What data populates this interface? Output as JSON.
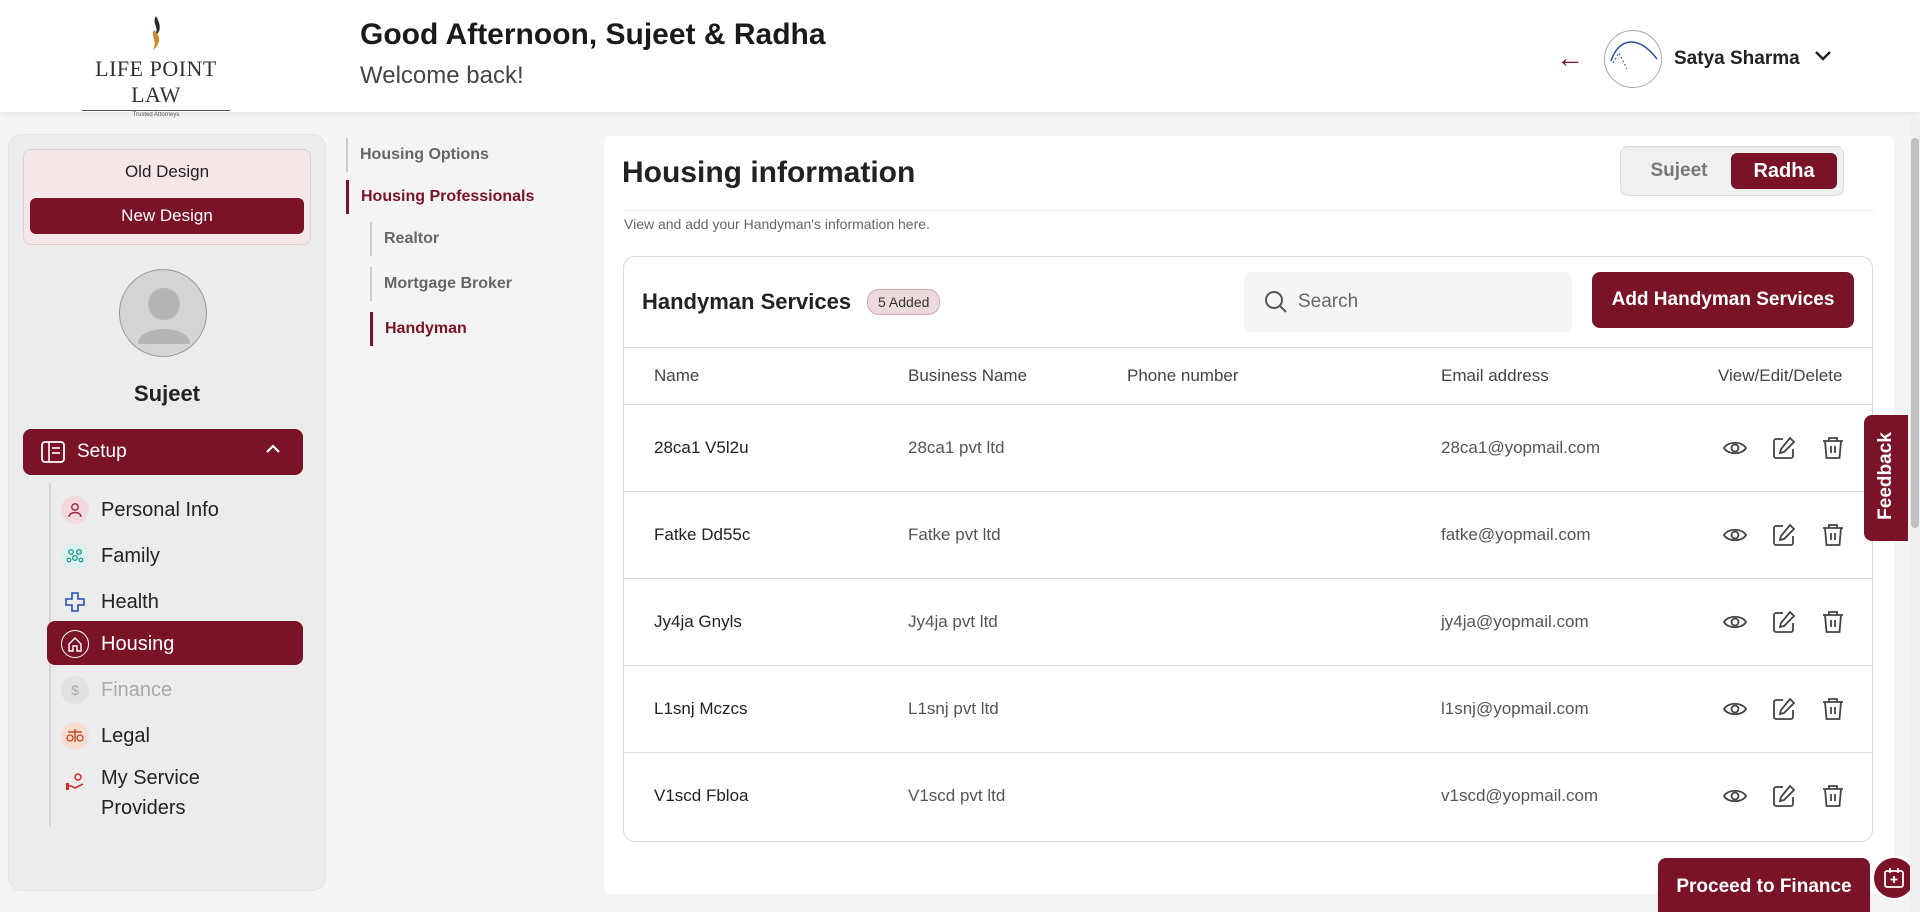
{
  "brand": {
    "name": "LIFE POINT LAW",
    "tagline": "Trusted Attorneys"
  },
  "header": {
    "greeting": "Good Afternoon, Sujeet & Radha",
    "subtitle": "Welcome back!",
    "user_name": "Satya Sharma"
  },
  "sidebar": {
    "old_design": "Old Design",
    "new_design": "New Design",
    "profile_name": "Sujeet",
    "setup_label": "Setup",
    "items": [
      {
        "label": "Personal Info",
        "icon": "person-icon"
      },
      {
        "label": "Family",
        "icon": "family-icon"
      },
      {
        "label": "Health",
        "icon": "health-cross-icon"
      },
      {
        "label": "Housing",
        "icon": "home-icon",
        "active": true
      },
      {
        "label": "Finance",
        "icon": "dollar-icon",
        "disabled": true
      },
      {
        "label": "Legal",
        "icon": "scales-icon"
      },
      {
        "label": "My Service Providers",
        "icon": "service-hand-icon"
      }
    ]
  },
  "subnav": {
    "items": [
      {
        "label": "Housing Options"
      },
      {
        "label": "Housing Professionals",
        "active": true
      },
      {
        "label": "Realtor"
      },
      {
        "label": "Mortgage Broker"
      },
      {
        "label": "Handyman",
        "active": true
      }
    ]
  },
  "main": {
    "title": "Housing information",
    "subtitle": "View and add your Handyman's information here.",
    "toggle": {
      "option_1": "Sujeet",
      "option_2": "Radha",
      "selected": "Radha"
    },
    "card": {
      "title": "Handyman Services",
      "badge": "5 Added",
      "search_placeholder": "Search",
      "add_button": "Add Handyman Services",
      "columns": [
        "Name",
        "Business Name",
        "Phone number",
        "Email address",
        "View/Edit/Delete"
      ],
      "rows": [
        {
          "name": "28ca1 V5l2u",
          "business": "28ca1 pvt ltd",
          "phone": "",
          "email": "28ca1@yopmail.com"
        },
        {
          "name": "Fatke Dd55c",
          "business": "Fatke pvt ltd",
          "phone": "",
          "email": "fatke@yopmail.com"
        },
        {
          "name": "Jy4ja Gnyls",
          "business": "Jy4ja pvt ltd",
          "phone": "",
          "email": "jy4ja@yopmail.com"
        },
        {
          "name": "L1snj Mczcs",
          "business": "L1snj pvt ltd",
          "phone": "",
          "email": "l1snj@yopmail.com"
        },
        {
          "name": "V1scd Fbloa",
          "business": "V1scd pvt ltd",
          "phone": "",
          "email": "v1scd@yopmail.com"
        }
      ]
    },
    "proceed_button": "Proceed to Finance"
  },
  "feedback_label": "Feedback",
  "colors": {
    "brand": "#7a1327",
    "background": "#f4f4f4",
    "panel": "#ffffff"
  }
}
